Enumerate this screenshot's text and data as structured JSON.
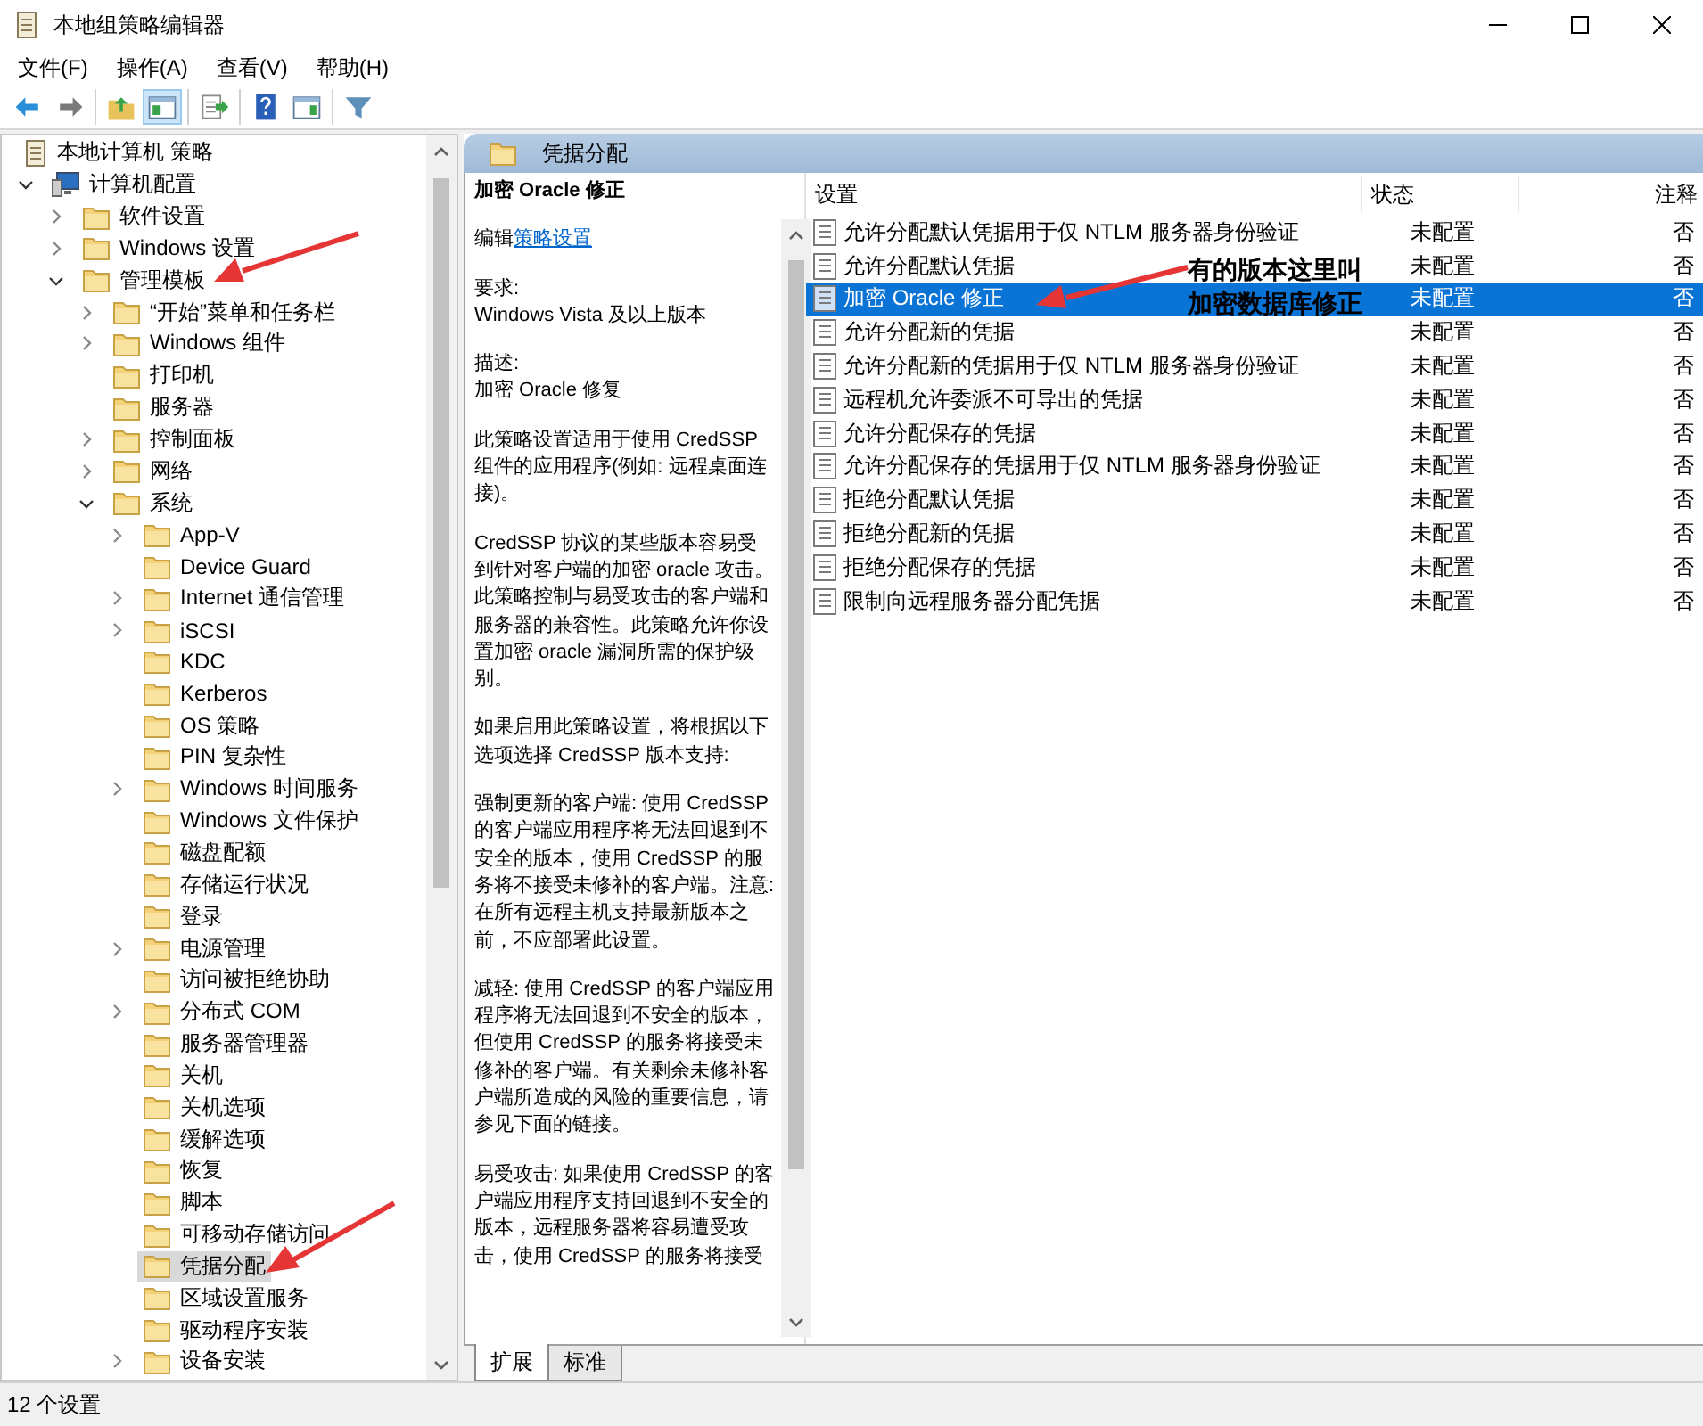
{
  "window": {
    "title": "本地组策略编辑器"
  },
  "menu": [
    "文件(F)",
    "操作(A)",
    "查看(V)",
    "帮助(H)"
  ],
  "toolbar": [
    [
      {
        "kind": "back",
        "pressed": false
      },
      {
        "kind": "forward",
        "pressed": false
      }
    ],
    [
      {
        "kind": "up",
        "pressed": false
      },
      {
        "kind": "tree",
        "pressed": true
      }
    ],
    [
      {
        "kind": "export",
        "pressed": false
      }
    ],
    [
      {
        "kind": "help",
        "pressed": false
      },
      {
        "kind": "pane",
        "pressed": false
      }
    ],
    [
      {
        "kind": "filter",
        "pressed": false
      }
    ]
  ],
  "tree": {
    "label": "本地计算机 策略",
    "kind": "root",
    "selected": false,
    "children": [
      {
        "label": "计算机配置",
        "kind": "computer",
        "expanded": true,
        "selected": false,
        "children": [
          {
            "label": "软件设置",
            "expanded": false,
            "selected": false
          },
          {
            "label": "Windows 设置",
            "expanded": false,
            "selected": false
          },
          {
            "label": "管理模板",
            "expanded": true,
            "selected": false,
            "children": [
              {
                "label": "“开始”菜单和任务栏",
                "expanded": false,
                "selected": false
              },
              {
                "label": "Windows 组件",
                "expanded": false,
                "selected": false
              },
              {
                "label": "打印机",
                "selected": false
              },
              {
                "label": "服务器",
                "selected": false
              },
              {
                "label": "控制面板",
                "expanded": false,
                "selected": false
              },
              {
                "label": "网络",
                "expanded": false,
                "selected": false
              },
              {
                "label": "系统",
                "expanded": true,
                "selected": false,
                "children": [
                  {
                    "label": "App-V",
                    "expanded": false,
                    "selected": false
                  },
                  {
                    "label": "Device Guard",
                    "selected": false
                  },
                  {
                    "label": "Internet 通信管理",
                    "expanded": false,
                    "selected": false
                  },
                  {
                    "label": "iSCSI",
                    "expanded": false,
                    "selected": false
                  },
                  {
                    "label": "KDC",
                    "selected": false
                  },
                  {
                    "label": "Kerberos",
                    "selected": false
                  },
                  {
                    "label": "OS 策略",
                    "selected": false
                  },
                  {
                    "label": "PIN 复杂性",
                    "selected": false
                  },
                  {
                    "label": "Windows 时间服务",
                    "expanded": false,
                    "selected": false
                  },
                  {
                    "label": "Windows 文件保护",
                    "selected": false
                  },
                  {
                    "label": "磁盘配额",
                    "selected": false
                  },
                  {
                    "label": "存储运行状况",
                    "selected": false
                  },
                  {
                    "label": "登录",
                    "selected": false
                  },
                  {
                    "label": "电源管理",
                    "expanded": false,
                    "selected": false
                  },
                  {
                    "label": "访问被拒绝协助",
                    "selected": false
                  },
                  {
                    "label": "分布式 COM",
                    "expanded": false,
                    "selected": false
                  },
                  {
                    "label": "服务器管理器",
                    "selected": false
                  },
                  {
                    "label": "关机",
                    "selected": false
                  },
                  {
                    "label": "关机选项",
                    "selected": false
                  },
                  {
                    "label": "缓解选项",
                    "selected": false
                  },
                  {
                    "label": "恢复",
                    "selected": false
                  },
                  {
                    "label": "脚本",
                    "selected": false
                  },
                  {
                    "label": "可移动存储访问",
                    "selected": false
                  },
                  {
                    "label": "凭据分配",
                    "selected": true
                  },
                  {
                    "label": "区域设置服务",
                    "selected": false
                  },
                  {
                    "label": "驱动程序安装",
                    "selected": false
                  },
                  {
                    "label": "设备安装",
                    "expanded": false,
                    "selected": false
                  }
                ]
              }
            ]
          }
        ]
      }
    ]
  },
  "header": {
    "title": "凭据分配"
  },
  "description": {
    "title": "加密 Oracle 修正",
    "edit_label": "编辑",
    "edit_link": "策略设置",
    "blocks": [
      {
        "label": "要求:",
        "text": "Windows Vista 及以上版本"
      },
      {
        "label": "描述:",
        "text": "加密 Oracle 修复"
      },
      {
        "text": "此策略设置适用于使用 CredSSP 组件的应用程序(例如: 远程桌面连接)。"
      },
      {
        "text": "CredSSP 协议的某些版本容易受到针对客户端的加密 oracle 攻击。此策略控制与易受攻击的客户端和服务器的兼容性。此策略允许你设置加密 oracle 漏洞所需的保护级别。"
      },
      {
        "text": "如果启用此策略设置，将根据以下选项选择 CredSSP 版本支持:"
      },
      {
        "text": "强制更新的客户端: 使用 CredSSP 的客户端应用程序将无法回退到不安全的版本，使用 CredSSP 的服务将不接受未修补的客户端。注意: 在所有远程主机支持最新版本之前，不应部署此设置。"
      },
      {
        "text": "减轻: 使用 CredSSP 的客户端应用程序将无法回退到不安全的版本，但使用 CredSSP 的服务将接受未修补的客户端。有关剩余未修补客户端所造成的风险的重要信息，请参见下面的链接。"
      },
      {
        "text": "易受攻击: 如果使用 CredSSP 的客户端应用程序支持回退到不安全的版本，远程服务器将容易遭受攻击，使用 CredSSP 的服务将接受"
      }
    ]
  },
  "table": {
    "columns": [
      "设置",
      "状态",
      "注释"
    ],
    "rows": [
      {
        "name": "允许分配默认凭据用于仅 NTLM 服务器身份验证",
        "state": "未配置",
        "comment": "否",
        "selected": false
      },
      {
        "name": "允许分配默认凭据",
        "state": "未配置",
        "comment": "否",
        "selected": false
      },
      {
        "name": "加密 Oracle 修正",
        "state": "未配置",
        "comment": "否",
        "selected": true
      },
      {
        "name": "允许分配新的凭据",
        "state": "未配置",
        "comment": "否",
        "selected": false
      },
      {
        "name": "允许分配新的凭据用于仅 NTLM 服务器身份验证",
        "state": "未配置",
        "comment": "否",
        "selected": false
      },
      {
        "name": "远程机允许委派不可导出的凭据",
        "state": "未配置",
        "comment": "否",
        "selected": false
      },
      {
        "name": "允许分配保存的凭据",
        "state": "未配置",
        "comment": "否",
        "selected": false
      },
      {
        "name": "允许分配保存的凭据用于仅 NTLM 服务器身份验证",
        "state": "未配置",
        "comment": "否",
        "selected": false
      },
      {
        "name": "拒绝分配默认凭据",
        "state": "未配置",
        "comment": "否",
        "selected": false
      },
      {
        "name": "拒绝分配新的凭据",
        "state": "未配置",
        "comment": "否",
        "selected": false
      },
      {
        "name": "拒绝分配保存的凭据",
        "state": "未配置",
        "comment": "否",
        "selected": false
      },
      {
        "name": "限制向远程服务器分配凭据",
        "state": "未配置",
        "comment": "否",
        "selected": false
      }
    ]
  },
  "tabs": [
    {
      "label": "扩展",
      "selected": true
    },
    {
      "label": "标准",
      "selected": false
    }
  ],
  "status_bar": "12 个设置",
  "annotation": [
    "有的版本这里叫",
    "加密数据库修正"
  ]
}
